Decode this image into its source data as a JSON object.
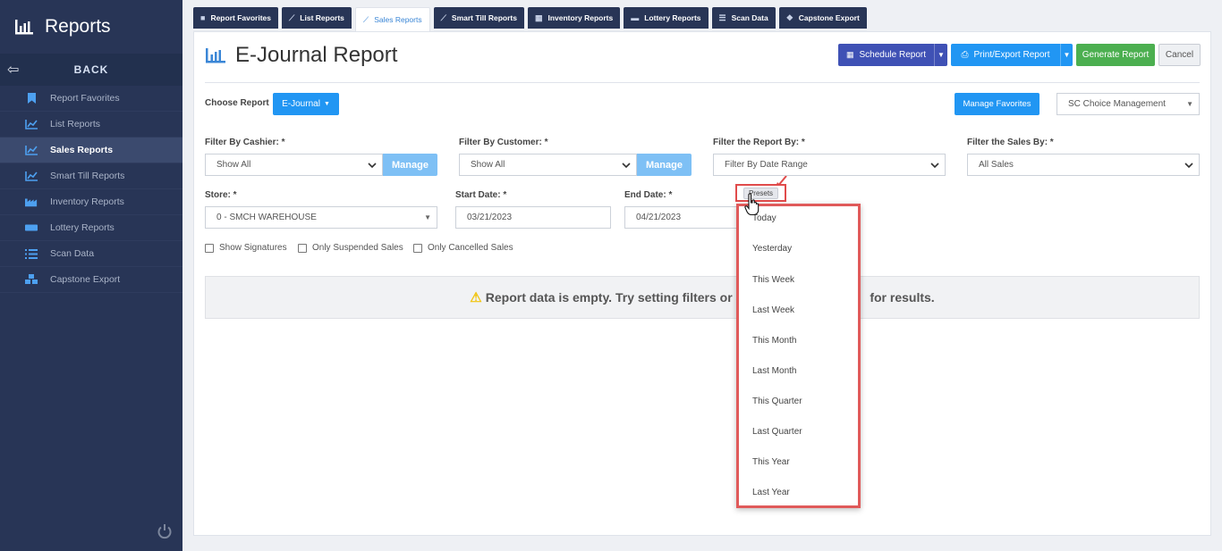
{
  "sidebar": {
    "title": "Reports",
    "back_label": "BACK",
    "items": [
      {
        "label": "Report Favorites",
        "icon": "bookmark-icon"
      },
      {
        "label": "List Reports",
        "icon": "line-chart-icon"
      },
      {
        "label": "Sales Reports",
        "icon": "line-chart-icon",
        "active": true
      },
      {
        "label": "Smart Till Reports",
        "icon": "line-chart-icon"
      },
      {
        "label": "Inventory Reports",
        "icon": "factory-icon"
      },
      {
        "label": "Lottery Reports",
        "icon": "ticket-icon"
      },
      {
        "label": "Scan Data",
        "icon": "list-icon"
      },
      {
        "label": "Capstone Export",
        "icon": "cubes-icon"
      }
    ]
  },
  "tabs": [
    {
      "label": "Report Favorites",
      "icon": "bookmark-icon"
    },
    {
      "label": "List Reports",
      "icon": "line-chart-icon"
    },
    {
      "label": "Sales Reports",
      "icon": "line-chart-icon",
      "active": true
    },
    {
      "label": "Smart Till Reports",
      "icon": "line-chart-icon"
    },
    {
      "label": "Inventory Reports",
      "icon": "factory-icon"
    },
    {
      "label": "Lottery Reports",
      "icon": "ticket-icon"
    },
    {
      "label": "Scan Data",
      "icon": "list-icon"
    },
    {
      "label": "Capstone Export",
      "icon": "cubes-icon"
    }
  ],
  "page": {
    "title": "E-Journal Report",
    "buttons": {
      "schedule": "Schedule Report",
      "print_export": "Print/Export Report",
      "generate": "Generate Report",
      "cancel": "Cancel",
      "manage_favorites": "Manage Favorites"
    },
    "choose_report_label": "Choose Report",
    "choose_report_value": "E-Journal",
    "company": "SC Choice Management"
  },
  "filters": {
    "cashier": {
      "label": "Filter By Cashier: *",
      "value": "Show All",
      "manage": "Manage"
    },
    "customer": {
      "label": "Filter By Customer: *",
      "value": "Show All",
      "manage": "Manage"
    },
    "report_by": {
      "label": "Filter the Report By: *",
      "value": "Filter By Date Range"
    },
    "sales_by": {
      "label": "Filter the Sales By: *",
      "value": "All Sales"
    },
    "store": {
      "label": "Store: *",
      "value": "0 - SMCH WAREHOUSE"
    },
    "start_date": {
      "label": "Start Date: *",
      "value": "03/21/2023"
    },
    "end_date": {
      "label": "End Date: *",
      "value": "04/21/2023"
    }
  },
  "checkboxes": {
    "signatures": "Show Signatures",
    "suspended": "Only Suspended Sales",
    "cancelled": "Only Cancelled Sales"
  },
  "empty_message": {
    "left": "Report data is empty. Try setting filters or a",
    "right": "for results."
  },
  "presets": {
    "button": "Presets",
    "options": [
      "Today",
      "Yesterday",
      "This Week",
      "Last Week",
      "This Month",
      "Last Month",
      "This Quarter",
      "Last Quarter",
      "This Year",
      "Last Year"
    ]
  },
  "colors": {
    "sidebar_bg": "#283556",
    "accent_blue": "#2196f3",
    "schedule_purple": "#3f51b5",
    "generate_green": "#4caf50",
    "highlight_red": "#e05a5a"
  }
}
